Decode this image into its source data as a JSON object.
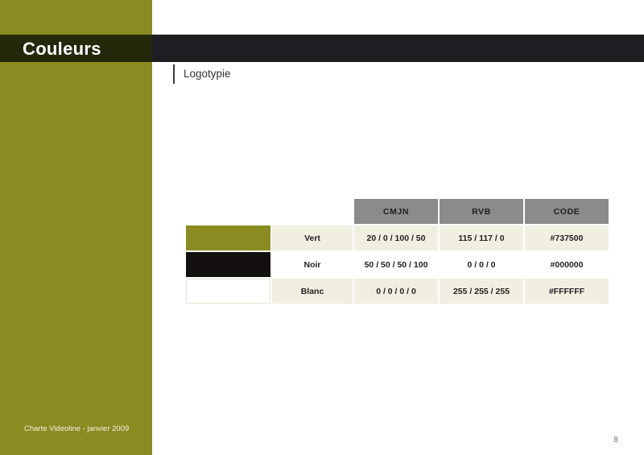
{
  "slide": {
    "title": "Couleurs",
    "subtitle": "Logotypie",
    "page_number": "8",
    "footer": "Charte Videoline - janvier 2009",
    "colors": {
      "sidebar": "#8a8c21",
      "header_band_right": "#1d1e22",
      "header_band_left": "#24290c",
      "title_text": "#ffffff",
      "table_header": "#8b8b8b",
      "row_alt": "#f0efe2",
      "row_plain": "#ffffff",
      "page_background": "#ffffff"
    }
  },
  "table": {
    "headers": {
      "swatch": "",
      "name": "",
      "cmjn": "CMJN",
      "rvb": "RVB",
      "code": "CODE"
    },
    "rows": [
      {
        "name": "Vert",
        "cmjn": "20 / 0 / 100 / 50",
        "rvb": "115 / 117 / 0",
        "code": "#737500",
        "swatch": "#8a8c21"
      },
      {
        "name": "Noir",
        "cmjn": "50 / 50 / 50 / 100",
        "rvb": "0 / 0 / 0",
        "code": "#000000",
        "swatch": "#141010"
      },
      {
        "name": "Blanc",
        "cmjn": "0 / 0 / 0 / 0",
        "rvb": "255 / 255 / 255",
        "code": "#FFFFFF",
        "swatch": "#ffffff"
      }
    ]
  }
}
